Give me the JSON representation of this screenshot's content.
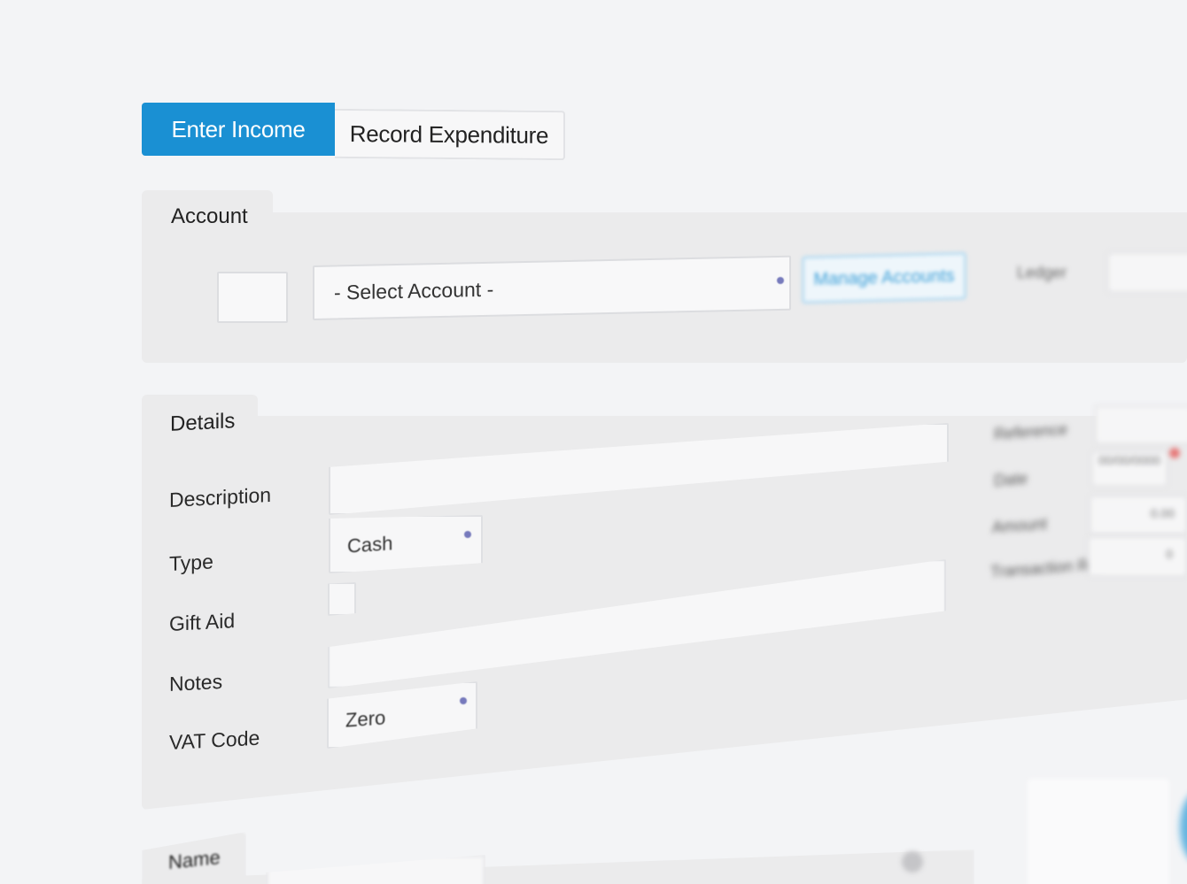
{
  "tabs": {
    "enter_income": "Enter Income",
    "record_expenditure": "Record Expenditure"
  },
  "account": {
    "section_title": "Account",
    "select_value": "- Select Account -",
    "manage_button": "Manage Accounts",
    "ledger_label": "Ledger"
  },
  "details": {
    "section_title": "Details",
    "description_label": "Description",
    "type_label": "Type",
    "type_value": "Cash",
    "gift_aid_label": "Gift Aid",
    "notes_label": "Notes",
    "vat_code_label": "VAT Code",
    "vat_code_value": "Zero"
  },
  "side": {
    "reference_label": "Reference",
    "date_label": "Date",
    "date_value": "00/00/0000",
    "amount_label": "Amount",
    "amount_value": "0.00",
    "vat_amount_label": "Transaction Ref",
    "vat_amount_value": "0"
  },
  "name_section": {
    "title": "Name"
  },
  "colors": {
    "accent": "#1a90d3",
    "background": "#f3f4f6",
    "panel": "#ebebec"
  }
}
